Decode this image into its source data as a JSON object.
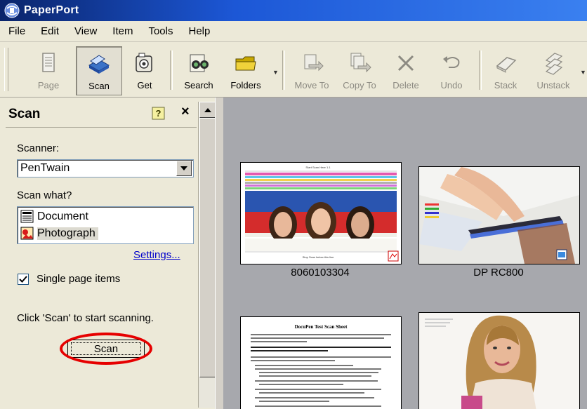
{
  "window": {
    "title": "PaperPort"
  },
  "menu": [
    "File",
    "Edit",
    "View",
    "Item",
    "Tools",
    "Help"
  ],
  "toolbar": {
    "page": "Page",
    "scan": "Scan",
    "get": "Get",
    "search": "Search",
    "folders": "Folders",
    "move_to": "Move To",
    "copy_to": "Copy To",
    "delete": "Delete",
    "undo": "Undo",
    "stack": "Stack",
    "unstack": "Unstack"
  },
  "scan_pane": {
    "title": "Scan",
    "scanner_label": "Scanner:",
    "scanner_value": "PenTwain",
    "scan_what_label": "Scan what?",
    "options": [
      "Document",
      "Photograph"
    ],
    "selected_option": "Photograph",
    "settings_link": "Settings...",
    "single_page_label": "Single page items",
    "single_page_checked": true,
    "instruction": "Click 'Scan' to start scanning.",
    "scan_button": "Scan"
  },
  "gallery": {
    "items": [
      {
        "caption": "8060103304",
        "kind": "scan-test-sheet",
        "texts": [
          "Start Scan Here 1.1",
          "Start Scan Above this Line",
          "Stop Scan below this line"
        ]
      },
      {
        "caption": "DP RC800",
        "kind": "scanner-photo"
      },
      {
        "caption": "",
        "kind": "document",
        "texts": [
          "DocuPen Test Scan Sheet"
        ]
      },
      {
        "caption": "",
        "kind": "portrait-photo"
      }
    ]
  }
}
